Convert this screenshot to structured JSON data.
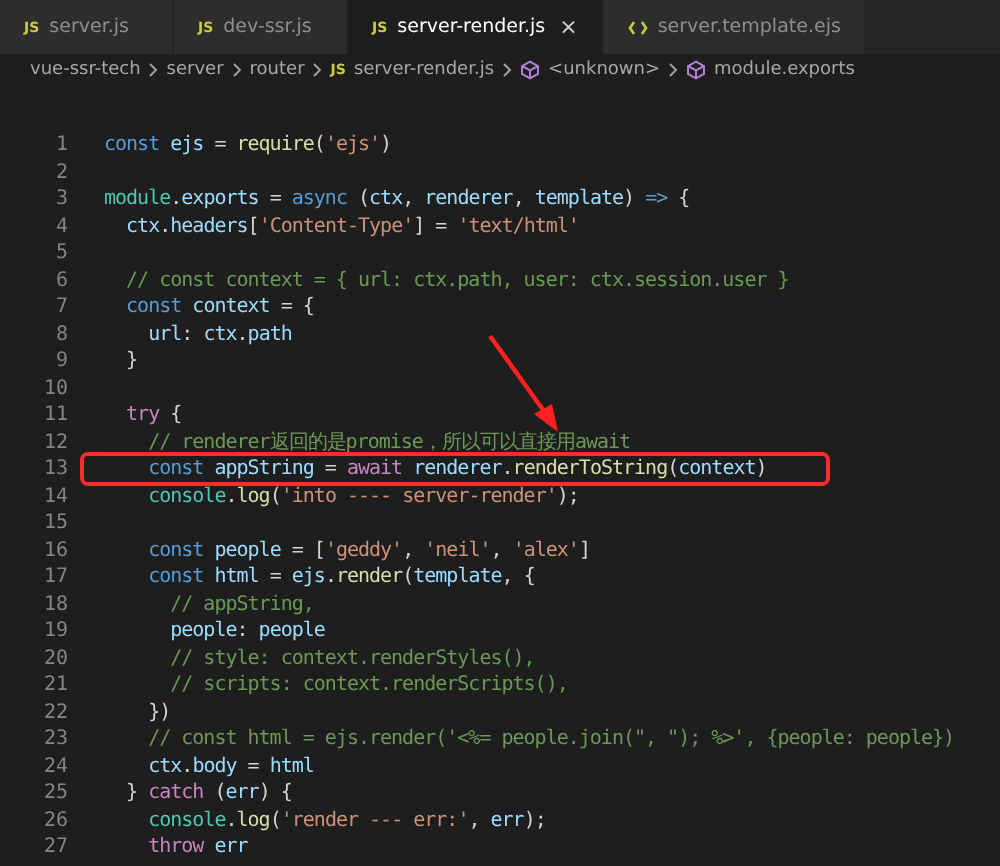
{
  "tabs": [
    {
      "label": "server.js",
      "kind": "script",
      "badge": "JS",
      "selected": false
    },
    {
      "label": "dev-ssr.js",
      "kind": "script",
      "badge": "JS",
      "selected": false
    },
    {
      "label": "server-render.js",
      "kind": "script",
      "badge": "JS",
      "selected": true,
      "close": "×"
    },
    {
      "label": "server.template.ejs",
      "kind": "template",
      "selected": false
    }
  ],
  "breadcrumb": [
    {
      "label": "vue-ssr-tech",
      "kind": "folder"
    },
    {
      "label": "server",
      "kind": "folder"
    },
    {
      "label": "router",
      "kind": "folder"
    },
    {
      "label": "server-render.js",
      "kind": "file",
      "badge": "JS"
    },
    {
      "label": "<unknown>",
      "kind": "symbol"
    },
    {
      "label": "module.exports",
      "kind": "symbol"
    }
  ],
  "editor": {
    "lines": [
      {
        "number": "1",
        "boxed": false,
        "tokens": [
          {
            "kind": "kw",
            "text": "const "
          },
          {
            "kind": "var",
            "text": "ejs"
          },
          {
            "kind": "p",
            "text": " = "
          },
          {
            "kind": "fn",
            "text": "require"
          },
          {
            "kind": "p",
            "text": "("
          },
          {
            "kind": "str",
            "text": "'ejs'"
          },
          {
            "kind": "p",
            "text": ")"
          }
        ]
      },
      {
        "number": "2",
        "boxed": false
      },
      {
        "number": "3",
        "boxed": false,
        "tokens": [
          {
            "kind": "type",
            "text": "module"
          },
          {
            "kind": "p",
            "text": "."
          },
          {
            "kind": "var",
            "text": "exports"
          },
          {
            "kind": "p",
            "text": " = "
          },
          {
            "kind": "kw",
            "text": "async "
          },
          {
            "kind": "p",
            "text": "("
          },
          {
            "kind": "var",
            "text": "ctx"
          },
          {
            "kind": "p",
            "text": ", "
          },
          {
            "kind": "var",
            "text": "renderer"
          },
          {
            "kind": "p",
            "text": ", "
          },
          {
            "kind": "var",
            "text": "template"
          },
          {
            "kind": "p",
            "text": ") "
          },
          {
            "kind": "kw",
            "text": "=>"
          },
          {
            "kind": "p",
            "text": " {"
          }
        ]
      },
      {
        "number": "4",
        "boxed": false,
        "tokens": [
          {
            "kind": "var",
            "text": "  ctx"
          },
          {
            "kind": "p",
            "text": "."
          },
          {
            "kind": "var",
            "text": "headers"
          },
          {
            "kind": "p",
            "text": "["
          },
          {
            "kind": "str",
            "text": "'Content-Type'"
          },
          {
            "kind": "p",
            "text": "] = "
          },
          {
            "kind": "str",
            "text": "'text/html'"
          }
        ]
      },
      {
        "number": "5",
        "boxed": false
      },
      {
        "number": "6",
        "boxed": false,
        "tokens": [
          {
            "kind": "cm",
            "text": "  // const context = { url: ctx.path, user: ctx.session.user }"
          }
        ]
      },
      {
        "number": "7",
        "boxed": false,
        "tokens": [
          {
            "kind": "kw",
            "text": "  const "
          },
          {
            "kind": "var",
            "text": "context"
          },
          {
            "kind": "p",
            "text": " = {"
          }
        ]
      },
      {
        "number": "8",
        "boxed": false,
        "tokens": [
          {
            "kind": "var",
            "text": "    url"
          },
          {
            "kind": "p",
            "text": ": "
          },
          {
            "kind": "var",
            "text": "ctx"
          },
          {
            "kind": "p",
            "text": "."
          },
          {
            "kind": "var",
            "text": "path"
          }
        ]
      },
      {
        "number": "9",
        "boxed": false,
        "tokens": [
          {
            "kind": "p",
            "text": "  }"
          }
        ]
      },
      {
        "number": "10",
        "boxed": false
      },
      {
        "number": "11",
        "boxed": false,
        "tokens": [
          {
            "kind": "ctl",
            "text": "  try"
          },
          {
            "kind": "p",
            "text": " {"
          }
        ]
      },
      {
        "number": "12",
        "boxed": false,
        "tokens": [
          {
            "kind": "cm",
            "text": "    // renderer返回的是promise，所以可以直接用await"
          }
        ]
      },
      {
        "number": "13",
        "boxed": true,
        "tokens": [
          {
            "kind": "kw",
            "text": "    const "
          },
          {
            "kind": "var",
            "text": "appString"
          },
          {
            "kind": "p",
            "text": " = "
          },
          {
            "kind": "ctl",
            "text": "await "
          },
          {
            "kind": "var",
            "text": "renderer"
          },
          {
            "kind": "p",
            "text": "."
          },
          {
            "kind": "fn",
            "text": "renderToString"
          },
          {
            "kind": "p",
            "text": "("
          },
          {
            "kind": "var",
            "text": "context"
          },
          {
            "kind": "p",
            "text": ")"
          }
        ]
      },
      {
        "number": "14",
        "boxed": false,
        "tokens": [
          {
            "kind": "type",
            "text": "    console"
          },
          {
            "kind": "p",
            "text": "."
          },
          {
            "kind": "fn",
            "text": "log"
          },
          {
            "kind": "p",
            "text": "("
          },
          {
            "kind": "str",
            "text": "'into ---- server-render'"
          },
          {
            "kind": "p",
            "text": ");"
          }
        ]
      },
      {
        "number": "15",
        "boxed": false
      },
      {
        "number": "16",
        "boxed": false,
        "tokens": [
          {
            "kind": "kw",
            "text": "    const "
          },
          {
            "kind": "var",
            "text": "people"
          },
          {
            "kind": "p",
            "text": " = ["
          },
          {
            "kind": "str",
            "text": "'geddy'"
          },
          {
            "kind": "p",
            "text": ", "
          },
          {
            "kind": "str",
            "text": "'neil'"
          },
          {
            "kind": "p",
            "text": ", "
          },
          {
            "kind": "str",
            "text": "'alex'"
          },
          {
            "kind": "p",
            "text": "]"
          }
        ]
      },
      {
        "number": "17",
        "boxed": false,
        "tokens": [
          {
            "kind": "kw",
            "text": "    const "
          },
          {
            "kind": "var",
            "text": "html"
          },
          {
            "kind": "p",
            "text": " = "
          },
          {
            "kind": "var",
            "text": "ejs"
          },
          {
            "kind": "p",
            "text": "."
          },
          {
            "kind": "fn",
            "text": "render"
          },
          {
            "kind": "p",
            "text": "("
          },
          {
            "kind": "var",
            "text": "template"
          },
          {
            "kind": "p",
            "text": ", {"
          }
        ]
      },
      {
        "number": "18",
        "boxed": false,
        "tokens": [
          {
            "kind": "cm",
            "text": "      // appString,"
          }
        ]
      },
      {
        "number": "19",
        "boxed": false,
        "tokens": [
          {
            "kind": "var",
            "text": "      people"
          },
          {
            "kind": "p",
            "text": ": "
          },
          {
            "kind": "var",
            "text": "people"
          }
        ]
      },
      {
        "number": "20",
        "boxed": false,
        "tokens": [
          {
            "kind": "cm",
            "text": "      // style: context.renderStyles(),"
          }
        ]
      },
      {
        "number": "21",
        "boxed": false,
        "tokens": [
          {
            "kind": "cm",
            "text": "      // scripts: context.renderScripts(),"
          }
        ]
      },
      {
        "number": "22",
        "boxed": false,
        "tokens": [
          {
            "kind": "p",
            "text": "    })"
          }
        ]
      },
      {
        "number": "23",
        "boxed": false,
        "tokens": [
          {
            "kind": "cm",
            "text": "    // const html = ejs.render('<%= people.join(\", \"); %>', {people: people})"
          }
        ]
      },
      {
        "number": "24",
        "boxed": false,
        "tokens": [
          {
            "kind": "var",
            "text": "    ctx"
          },
          {
            "kind": "p",
            "text": "."
          },
          {
            "kind": "var",
            "text": "body"
          },
          {
            "kind": "p",
            "text": " = "
          },
          {
            "kind": "var",
            "text": "html"
          }
        ]
      },
      {
        "number": "25",
        "boxed": false,
        "tokens": [
          {
            "kind": "p",
            "text": "  } "
          },
          {
            "kind": "ctl",
            "text": "catch"
          },
          {
            "kind": "p",
            "text": " ("
          },
          {
            "kind": "var",
            "text": "err"
          },
          {
            "kind": "p",
            "text": ") {"
          }
        ]
      },
      {
        "number": "26",
        "boxed": false,
        "tokens": [
          {
            "kind": "type",
            "text": "    console"
          },
          {
            "kind": "p",
            "text": "."
          },
          {
            "kind": "fn",
            "text": "log"
          },
          {
            "kind": "p",
            "text": "("
          },
          {
            "kind": "str",
            "text": "'render --- err:'"
          },
          {
            "kind": "p",
            "text": ", "
          },
          {
            "kind": "var",
            "text": "err"
          },
          {
            "kind": "p",
            "text": ");"
          }
        ]
      },
      {
        "number": "27",
        "boxed": false,
        "tokens": [
          {
            "kind": "ctl",
            "text": "    throw "
          },
          {
            "kind": "var",
            "text": "err"
          }
        ]
      }
    ]
  }
}
